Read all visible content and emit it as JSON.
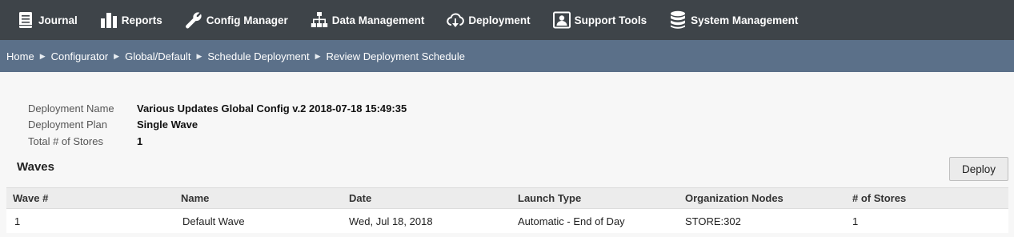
{
  "nav": {
    "items": [
      {
        "label": "Journal",
        "icon": "journal-icon"
      },
      {
        "label": "Reports",
        "icon": "bar-chart-icon"
      },
      {
        "label": "Config Manager",
        "icon": "wrench-icon"
      },
      {
        "label": "Data Management",
        "icon": "hierarchy-icon"
      },
      {
        "label": "Deployment",
        "icon": "cloud-download-icon"
      },
      {
        "label": "Support Tools",
        "icon": "support-tools-icon"
      },
      {
        "label": "System Management",
        "icon": "database-icon"
      }
    ]
  },
  "breadcrumb": [
    "Home",
    "Configurator",
    "Global/Default",
    "Schedule Deployment",
    "Review Deployment Schedule"
  ],
  "deployment": {
    "name_label": "Deployment Name",
    "name_value": "Various Updates Global Config v.2 2018-07-18 15:49:35",
    "plan_label": "Deployment Plan",
    "plan_value": "Single Wave",
    "stores_label": "Total # of Stores",
    "stores_value": "1"
  },
  "waves": {
    "title": "Waves",
    "deploy_label": "Deploy",
    "columns": [
      "Wave #",
      "Name",
      "Date",
      "Launch Type",
      "Organization Nodes",
      "# of Stores"
    ],
    "rows": [
      [
        "1",
        "Default Wave",
        "Wed, Jul 18, 2018",
        "Automatic - End of Day",
        "STORE:302",
        "1"
      ]
    ]
  },
  "colors": {
    "topnav_bg": "#3e4449",
    "breadcrumb_bg": "#5b7089",
    "content_bg": "#f7f7f7"
  }
}
